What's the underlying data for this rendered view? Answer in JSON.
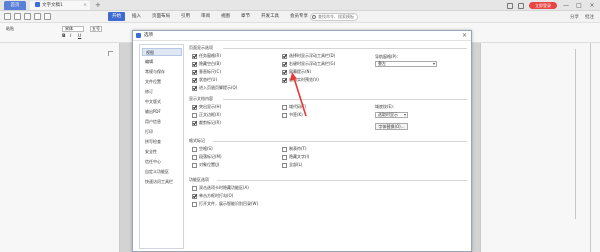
{
  "titlebar": {
    "home_tab": "首页",
    "doc_tab": "文字文稿1",
    "tab_close": "×",
    "tab_add": "+",
    "login": "立即登录",
    "min": "—",
    "max": "□",
    "close": "×"
  },
  "menubar": {
    "items": [
      "开始",
      "插入",
      "页面布局",
      "引用",
      "审阅",
      "视图",
      "章节",
      "开发工具",
      "会员专享"
    ],
    "active_index": 0,
    "search": "查找命令、搜索模板",
    "right": [
      "分享",
      "批注"
    ]
  },
  "toolbar": {
    "paste": "粘贴",
    "font": "宋体",
    "size": "五号",
    "bold": "B",
    "italic": "I",
    "underline": "U"
  },
  "dialog": {
    "title": "选项",
    "close": "×",
    "nav": [
      "视图",
      "编辑",
      "常规与保存",
      "文件位置",
      "修订",
      "中文版式",
      "输出PDF",
      "用户信息",
      "打印",
      "拼写检查",
      "安全性",
      "信任中心",
      "自定义功能区",
      "快速访问工具栏"
    ],
    "nav_selected": 0,
    "sections": {
      "page_display": "页面显示选项",
      "show_text": "显示文档内容",
      "format_marks": "格式标记",
      "function_options": "功能区选项"
    },
    "page_display_opts": [
      {
        "label": "任务窗格(R)",
        "on": true
      },
      {
        "label": "隐藏空白(B)",
        "on": true
      },
      {
        "label": "垂直标尺(C)",
        "on": true
      },
      {
        "label": "状态栏(U)",
        "on": true
      },
      {
        "label": "进入页眉页脚提示(Q)",
        "on": true
      }
    ],
    "page_display_opts_right": [
      {
        "label": "选择时显示浮动工具栏(D)",
        "on": true
      },
      {
        "label": "右键时显示浮动工具栏(G)",
        "on": true
      },
      {
        "label": "屏幕提示(N)",
        "on": true
      },
      {
        "label": "启用实时预览(V)",
        "on": true
      }
    ],
    "nav_pane_label": "导航窗格(P):",
    "nav_pane_value": "靠左",
    "show_text_opts": [
      {
        "label": "突出显示(H)",
        "on": true
      },
      {
        "label": "正文边框(X)",
        "on": false
      },
      {
        "label": "裁剪标记(R)",
        "on": true
      }
    ],
    "show_text_opts_right": [
      {
        "label": "域代码(F)",
        "on": false
      },
      {
        "label": "书签(K)",
        "on": false
      }
    ],
    "field_shading_label": "域底纹(E):",
    "field_shading_value": "选取时显示",
    "font_replace_btn": "字体替换(O)...",
    "format_opts_left": [
      {
        "label": "空格(S)",
        "on": false
      },
      {
        "label": "段落标记(M)",
        "on": false
      },
      {
        "label": "对象位置(J)",
        "on": false
      }
    ],
    "format_opts_right": [
      {
        "label": "制表符(T)",
        "on": false
      },
      {
        "label": "隐藏文字(I)",
        "on": false
      },
      {
        "label": "全部(L)",
        "on": false
      }
    ],
    "function_opts": [
      {
        "label": "双击选项卡时隐藏功能区(A)",
        "on": false
      },
      {
        "label": "单击方框时打勾(O)",
        "on": true
      },
      {
        "label": "打开文件，展示智能识别目录(W)",
        "on": false
      }
    ],
    "arrow_color": "#e53935"
  }
}
